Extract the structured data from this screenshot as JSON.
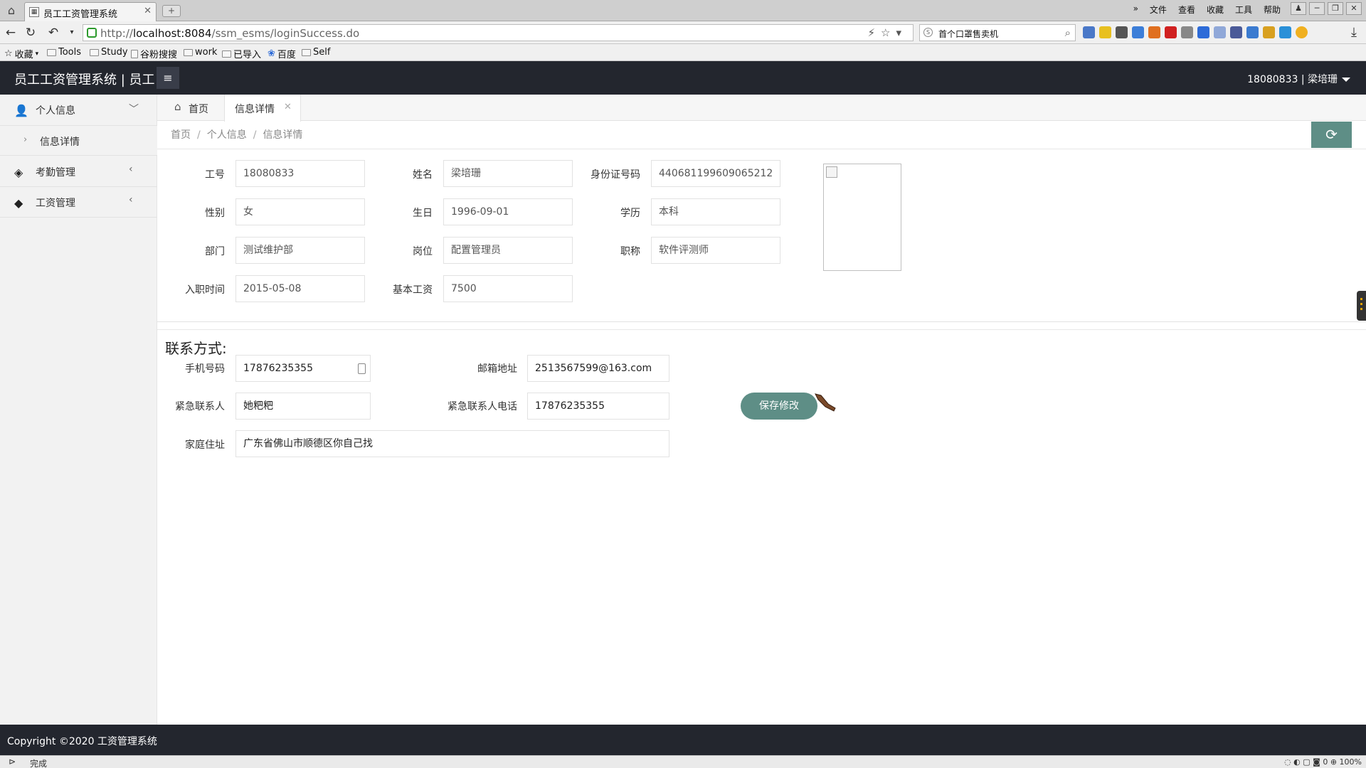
{
  "browser": {
    "tab_title": "员工工资管理系统",
    "url_prefix": "http://",
    "url_host": "localhost:8084",
    "url_path": "/ssm_esms/loginSuccess.do",
    "search_text": "首个口罩售卖机",
    "menus": [
      "文件",
      "查看",
      "收藏",
      "工具",
      "帮助"
    ],
    "bookmarks": [
      "收藏",
      "Tools",
      "Study",
      "谷粉搜搜",
      "work",
      "已导入",
      "百度",
      "Self"
    ],
    "status_text": "完成",
    "zoom": "100%",
    "status_count": "0"
  },
  "app": {
    "title": "员工工资管理系统 | 员工",
    "user": "18080833 | 梁培珊",
    "footer": "Copyright ©2020 工资管理系统"
  },
  "sidebar": {
    "items": [
      {
        "label": "个人信息",
        "icon": "user-icon"
      },
      {
        "label": "考勤管理",
        "icon": "layers-icon"
      },
      {
        "label": "工资管理",
        "icon": "tag-icon"
      }
    ],
    "sub_item": "信息详情"
  },
  "tabs": {
    "home": "首页",
    "active": "信息详情"
  },
  "breadcrumb": [
    "首页",
    "个人信息",
    "信息详情"
  ],
  "info": {
    "emp_no_label": "工号",
    "emp_no": "18080833",
    "name_label": "姓名",
    "name": "梁培珊",
    "id_label": "身份证号码",
    "id": "440681199609065212",
    "gender_label": "性别",
    "gender": "女",
    "birthday_label": "生日",
    "birthday": "1996-09-01",
    "education_label": "学历",
    "education": "本科",
    "dept_label": "部门",
    "dept": "测试维护部",
    "position_label": "岗位",
    "position": "配置管理员",
    "title_label": "职称",
    "title": "软件评测师",
    "hire_label": "入职时间",
    "hire": "2015-05-08",
    "salary_label": "基本工资",
    "salary": "7500"
  },
  "contact": {
    "heading": "联系方式:",
    "phone_label": "手机号码",
    "phone": "17876235355",
    "email_label": "邮箱地址",
    "email": "2513567599@163.com",
    "emergency_label": "紧急联系人",
    "emergency": "她粑粑",
    "emergency_phone_label": "紧急联系人电话",
    "emergency_phone": "17876235355",
    "address_label": "家庭住址",
    "address": "广东省佛山市顺德区你自己找",
    "save_label": "保存修改"
  },
  "colors": {
    "header_bg": "#23262e",
    "accent": "#5e8e86",
    "sidebar_bg": "#f2f2f2"
  }
}
